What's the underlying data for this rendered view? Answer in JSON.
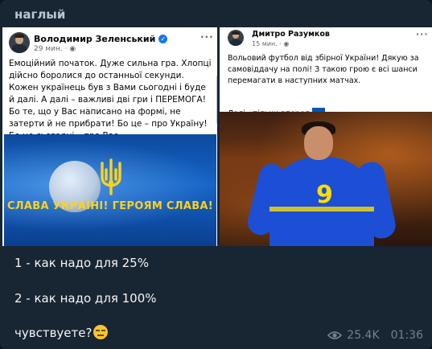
{
  "channel": {
    "name": "наглый"
  },
  "posts": [
    {
      "author": "Володимир Зеленський",
      "time": "29 мин.",
      "text": "Емоційний початок. Дуже сильна гра. Хлопці дійсно боролися до останньої секунди. Кожен українець був з Вами сьогодні і буде й далі. А далі – важливі дві гри і ПЕРЕМОГА! Бо те, що у Вас написано на формі, не затерти й не прибрати! Бо це – про Україну! Бо це сьогодні – про Вас.",
      "image_text": "СЛАВА УКРАЇНІ! ГЕРОЯМ СЛАВА!"
    },
    {
      "author": "Дмитро Разумков",
      "time": "15 мин.",
      "text": "Вольовий футбол від збірної України! Дякую за самовіддачу на полі! З такою грою є всі шанси перемагати в наступних матчах.",
      "text2": "Далі - тільки вперед",
      "shirt_number": "9"
    }
  ],
  "message": {
    "line1": "1 - как надо для 25%",
    "line2": "2 - как надо для 100%",
    "line3": "чувствуете?"
  },
  "meta": {
    "views": "25.4K",
    "time": "01:36"
  },
  "colors": {
    "background": "#182533",
    "accent_yellow": "#ffd21a",
    "facebook_blue": "#1877f2"
  }
}
